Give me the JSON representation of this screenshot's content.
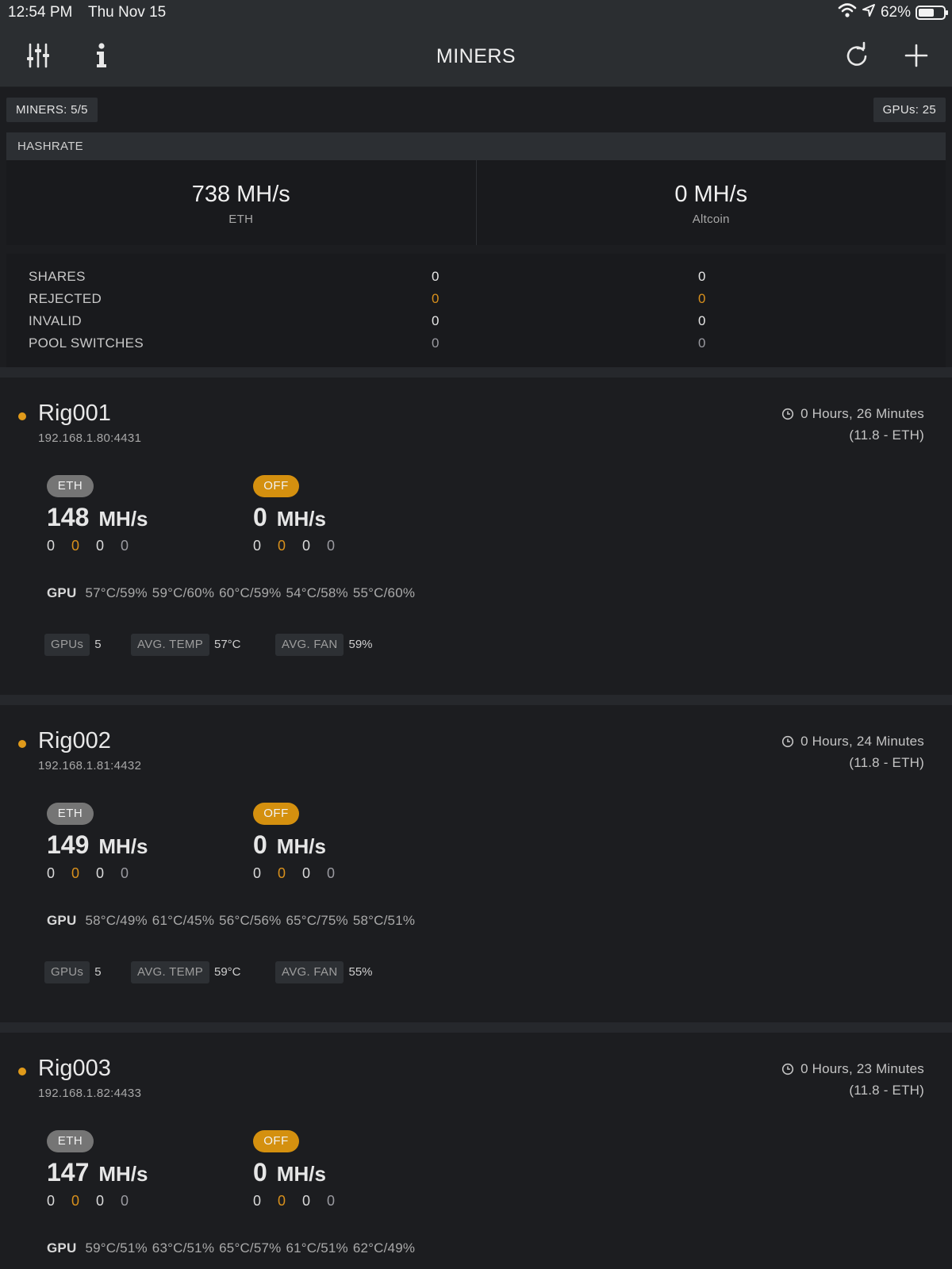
{
  "status_bar": {
    "time": "12:54 PM",
    "date": "Thu Nov 15",
    "battery": "62%",
    "battery_level": 0.62
  },
  "nav": {
    "title": "MINERS"
  },
  "summary": {
    "miners": "MINERS: 5/5",
    "gpus": "GPUs: 25"
  },
  "hashrate": {
    "header": "HASHRATE",
    "primary": {
      "rate": "738 MH/s",
      "coin": "ETH"
    },
    "secondary": {
      "rate": "0 MH/s",
      "coin": "Altcoin"
    }
  },
  "stats": [
    {
      "label": "SHARES",
      "v1": "0",
      "v2": "0"
    },
    {
      "label": "REJECTED",
      "v1": "0",
      "v2": "0"
    },
    {
      "label": "INVALID",
      "v1": "0",
      "v2": "0"
    },
    {
      "label": "POOL SWITCHES",
      "v1": "0",
      "v2": "0"
    }
  ],
  "rigs": [
    {
      "name": "Rig001",
      "ip": "192.168.1.80:4431",
      "uptime": "0 Hours, 26 Minutes",
      "version": "(11.8 - ETH)",
      "eth_badge": "ETH",
      "eth_rate": "148",
      "eth_unit": "MH/s",
      "eth_counts": [
        "0",
        "0",
        "0",
        "0"
      ],
      "alt_badge": "OFF",
      "alt_rate": "0",
      "alt_unit": "MH/s",
      "alt_counts": [
        "0",
        "0",
        "0",
        "0"
      ],
      "gpu_label": "GPU",
      "gpus": [
        "57°C/59%",
        "59°C/60%",
        "60°C/59%",
        "54°C/58%",
        "55°C/60%"
      ],
      "footer": {
        "gpus_label": "GPUs",
        "gpus_value": "5",
        "temp_label": "AVG. TEMP",
        "temp_value": "57°C",
        "fan_label": "AVG. FAN",
        "fan_value": "59%"
      }
    },
    {
      "name": "Rig002",
      "ip": "192.168.1.81:4432",
      "uptime": "0 Hours, 24 Minutes",
      "version": "(11.8 - ETH)",
      "eth_badge": "ETH",
      "eth_rate": "149",
      "eth_unit": "MH/s",
      "eth_counts": [
        "0",
        "0",
        "0",
        "0"
      ],
      "alt_badge": "OFF",
      "alt_rate": "0",
      "alt_unit": "MH/s",
      "alt_counts": [
        "0",
        "0",
        "0",
        "0"
      ],
      "gpu_label": "GPU",
      "gpus": [
        "58°C/49%",
        "61°C/45%",
        "56°C/56%",
        "65°C/75%",
        "58°C/51%"
      ],
      "footer": {
        "gpus_label": "GPUs",
        "gpus_value": "5",
        "temp_label": "AVG. TEMP",
        "temp_value": "59°C",
        "fan_label": "AVG. FAN",
        "fan_value": "55%"
      }
    },
    {
      "name": "Rig003",
      "ip": "192.168.1.82:4433",
      "uptime": "0 Hours, 23 Minutes",
      "version": "(11.8 - ETH)",
      "eth_badge": "ETH",
      "eth_rate": "147",
      "eth_unit": "MH/s",
      "eth_counts": [
        "0",
        "0",
        "0",
        "0"
      ],
      "alt_badge": "OFF",
      "alt_rate": "0",
      "alt_unit": "MH/s",
      "alt_counts": [
        "0",
        "0",
        "0",
        "0"
      ],
      "gpu_label": "GPU",
      "gpus": [
        "59°C/51%",
        "63°C/51%",
        "65°C/57%",
        "61°C/51%",
        "62°C/49%"
      ]
    }
  ]
}
